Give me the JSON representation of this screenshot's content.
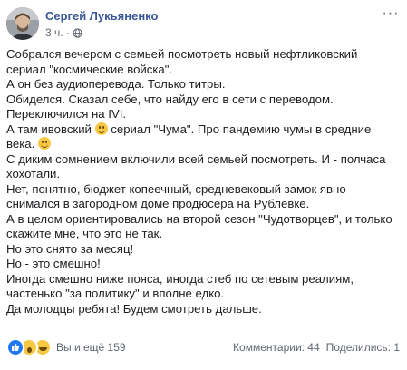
{
  "post": {
    "author": "Сергей Лукьяненко",
    "time": "3 ч.",
    "more_icon": "more-dots",
    "privacy_icon": "globe-icon",
    "paragraphs": [
      "Собрался вечером с семьей посмотреть новый нефтликовский сериал \"космические войска\".",
      "А он без аудиоперевода. Только титры.",
      "Обиделся. Сказал себе, что найду его в сети с переводом.",
      "Переключился на IVI.",
      null,
      "С диким сомнением включили всей семьей посмотреть. И - полчаса хохотали.",
      "Нет, понятно, бюджет копеечный, средневековый замок явно снимался в загородном доме продюсера на Рублевке.",
      "А в целом ориентировались на второй сезон \"Чудотворцев\", и только скажите мне, что это не так.",
      "Но это снято за месяц!",
      "Но - это смешно!",
      "Иногда смешно ниже пояса, иногда стеб по сетевым реалиям, частенько \"за политику\" и вполне едко.",
      "Да молодцы ребята! Будем смотреть дальше."
    ],
    "line5": {
      "part1": "А там ивовский",
      "part2": "сериал \"Чума\". Про пандемию чумы в средние века."
    }
  },
  "footer": {
    "reactions_label": "Вы и ещё 159",
    "reaction_icons": [
      "like-icon",
      "wow-icon",
      "haha-icon"
    ],
    "comments": "Комментарии: 44",
    "shares": "Поделились: 1"
  },
  "colors": {
    "author_link": "#385898",
    "like_blue": "#2078f4",
    "emoji_yellow": "#f7c843",
    "meta_gray": "#606770"
  }
}
